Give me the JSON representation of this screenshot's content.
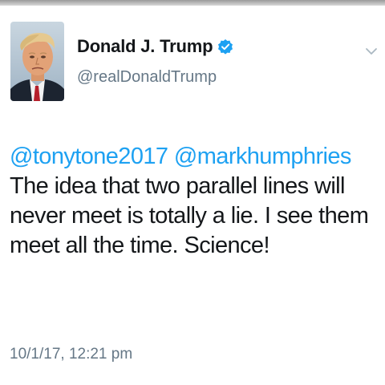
{
  "user": {
    "display_name": "Donald J. Trump",
    "handle": "@realDonaldTrump",
    "verified": true,
    "avatar_icon": "profile-photo"
  },
  "tweet": {
    "mentions": [
      "@tonytone2017",
      "@markhumphries"
    ],
    "text": "The idea that two parallel lines will never meet is totally a lie. I see them meet all the time. Science!",
    "timestamp": "10/1/17, 12:21 pm"
  },
  "icons": {
    "verified": "verified-badge-icon",
    "menu": "chevron-down-icon"
  },
  "colors": {
    "link": "#1da1f2",
    "muted": "#657786",
    "text": "#14171a",
    "verified": "#1da1f2"
  }
}
